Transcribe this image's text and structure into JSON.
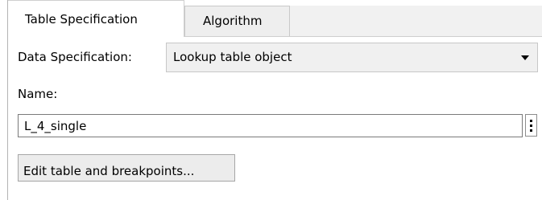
{
  "tabs": [
    {
      "label": "Table Specification",
      "active": true
    },
    {
      "label": "Algorithm",
      "active": false
    }
  ],
  "data_specification": {
    "label": "Data Specification:",
    "selected": "Lookup table object"
  },
  "name": {
    "label": "Name:",
    "value": "L_4_single"
  },
  "edit_button": {
    "label": "Edit table and breakpoints..."
  },
  "icons": {
    "select_arrow": "dropdown-arrow-icon",
    "name_menu": "kebab-menu-icon"
  },
  "colors": {
    "inactive_tab_bg": "#eeeeee",
    "select_bg": "#f0f0f0",
    "button_bg": "#ececec",
    "border": "#c7c7c7"
  }
}
